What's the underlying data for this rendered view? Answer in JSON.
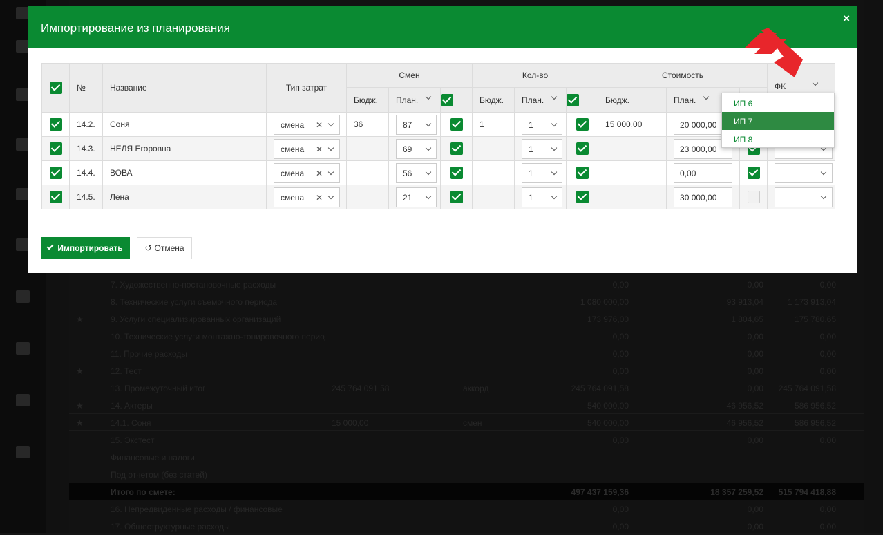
{
  "modal": {
    "title": "Импортирование из планирования",
    "close_label": "×",
    "header_color": "#0a8a32"
  },
  "table": {
    "headers": {
      "number": "№",
      "name": "Название",
      "cost_type": "Тип затрат",
      "shifts": "Смен",
      "quantity": "Кол-во",
      "cost": "Стоимость",
      "budget": "Бюдж.",
      "plan": "План.",
      "fk": "ФК"
    },
    "rows": [
      {
        "number": "14.2.",
        "name": "Соня",
        "cost_type": "смена",
        "shifts_budget": "36",
        "shifts_plan": "87",
        "qty_budget": "1",
        "qty_plan": "1",
        "cost_budget": "15 000,00",
        "cost_plan": "20 000,00",
        "cost_checked": true,
        "fk": ""
      },
      {
        "number": "14.3.",
        "name": "НЕЛЯ Егоровна",
        "cost_type": "смена",
        "shifts_budget": "",
        "shifts_plan": "69",
        "qty_budget": "",
        "qty_plan": "1",
        "cost_budget": "",
        "cost_plan": "23 000,00",
        "cost_checked": true,
        "fk": ""
      },
      {
        "number": "14.4.",
        "name": "ВОВА",
        "cost_type": "смена",
        "shifts_budget": "",
        "shifts_plan": "56",
        "qty_budget": "",
        "qty_plan": "1",
        "cost_budget": "",
        "cost_plan": "0,00",
        "cost_checked": true,
        "fk": ""
      },
      {
        "number": "14.5.",
        "name": "Лена",
        "cost_type": "смена",
        "shifts_budget": "",
        "shifts_plan": "21",
        "qty_budget": "",
        "qty_plan": "1",
        "cost_budget": "",
        "cost_plan": "30 000,00",
        "cost_checked": false,
        "fk": ""
      }
    ]
  },
  "fk_dropdown": {
    "options": [
      "ИП 6",
      "ИП 7",
      "ИП 8"
    ],
    "highlighted": "ИП 7"
  },
  "buttons": {
    "import_label": "Импортировать",
    "cancel_label": "Отмена"
  },
  "background": {
    "rows": [
      {
        "star": "",
        "label": "7. Художественно-постановочные расходы",
        "c1": "",
        "c2": "",
        "v1": "0,00",
        "v2": "0,00",
        "v3": "0,00"
      },
      {
        "star": "",
        "label": "8. Технические услуги съемочного периода",
        "c1": "",
        "c2": "",
        "v1": "1 080 000,00",
        "v2": "93 913,04",
        "v3": "1 173 913,04"
      },
      {
        "star": "★",
        "label": "9. Услуги специализированных организаций",
        "c1": "",
        "c2": "",
        "v1": "173 976,00",
        "v2": "1 804,65",
        "v3": "175 780,65"
      },
      {
        "star": "",
        "label": "10. Технические услуги монтажно-тонировочного периода",
        "c1": "",
        "c2": "",
        "v1": "0,00",
        "v2": "0,00",
        "v3": "0,00"
      },
      {
        "star": "",
        "label": "11. Прочие расходы",
        "c1": "",
        "c2": "",
        "v1": "0,00",
        "v2": "0,00",
        "v3": "0,00"
      },
      {
        "star": "★",
        "label": "12. Тест",
        "c1": "",
        "c2": "",
        "v1": "0,00",
        "v2": "0,00",
        "v3": "0,00"
      },
      {
        "star": "",
        "label": "13. Промежуточный итог",
        "c1": "245 764 091,58",
        "c2": "аккорд",
        "v1": "245 764 091,58",
        "v2": "0,00",
        "v3": "245 764 091,58"
      },
      {
        "star": "★",
        "label": "14. Актеры",
        "c1": "",
        "c2": "",
        "v1": "540 000,00",
        "v2": "46 956,52",
        "v3": "586 956,52"
      },
      {
        "star": "★",
        "label": "14.1.    Соня",
        "c1": "15 000,00",
        "c2": "смен",
        "v1": "540 000,00",
        "v2": "46 956,52",
        "v3": "586 956,52"
      },
      {
        "star": "",
        "label": "15. Экстест",
        "c1": "",
        "c2": "",
        "v1": "0,00",
        "v2": "0,00",
        "v3": "0,00"
      },
      {
        "star": "",
        "label": "Финансовые и налоги",
        "c1": "",
        "c2": "",
        "v1": "",
        "v2": "",
        "v3": ""
      },
      {
        "star": "",
        "label": "Под отчетом (без статей)",
        "c1": "",
        "c2": "",
        "v1": "",
        "v2": "",
        "v3": ""
      },
      {
        "star": "",
        "label": "Итого по смете:",
        "c1": "",
        "c2": "",
        "v1": "497 437 159,36",
        "v2": "18 357 259,52",
        "v3": "515 794 418,88"
      },
      {
        "star": "",
        "label": "16. Непредвиденные расходы / финансовые",
        "c1": "",
        "c2": "",
        "v1": "0,00",
        "v2": "0,00",
        "v3": "0,00"
      },
      {
        "star": "",
        "label": "17. Общеструктурные расходы",
        "c1": "",
        "c2": "",
        "v1": "0,00",
        "v2": "0,00",
        "v3": "0,00"
      }
    ]
  },
  "colors": {
    "accent": "#0a8a32",
    "dropdown_active": "#2e8a42",
    "arrow": "#e8262b"
  }
}
